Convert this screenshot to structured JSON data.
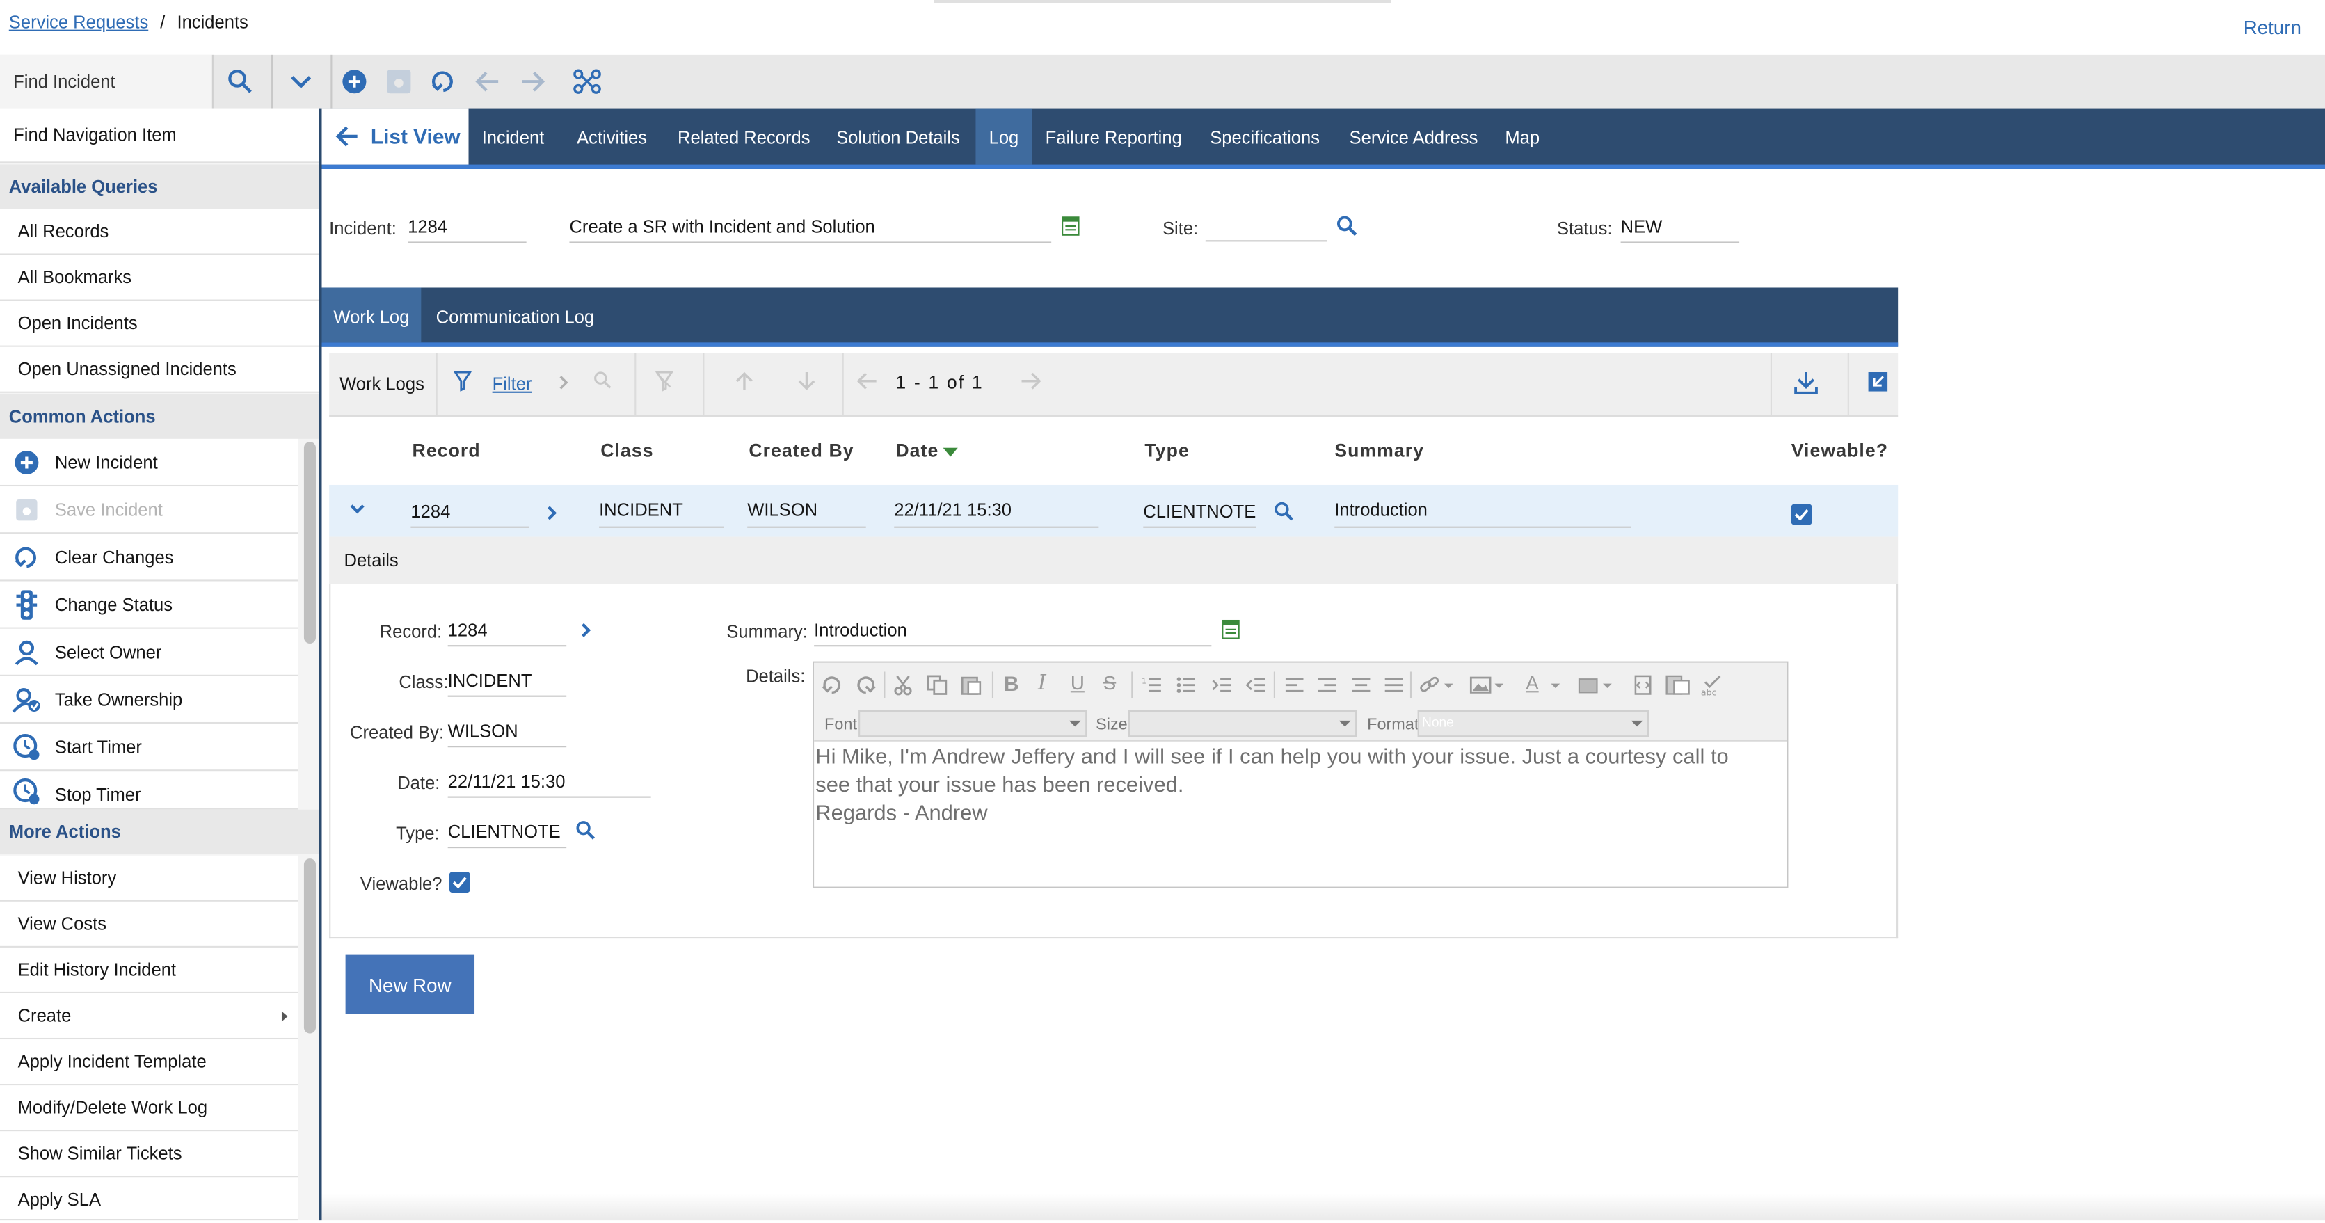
{
  "breadcrumb": {
    "link": "Service Requests",
    "separator": "/",
    "current": "Incidents"
  },
  "return_label": "Return",
  "toolbar": {
    "find_incident": "Find Incident"
  },
  "sidebar": {
    "find_nav": "Find Navigation Item",
    "available_queries_title": "Available Queries",
    "queries": [
      "All Records",
      "All Bookmarks",
      "Open Incidents",
      "Open Unassigned Incidents"
    ],
    "common_actions_title": "Common Actions",
    "common_actions": [
      {
        "label": "New Incident",
        "icon": "plus-circle-icon"
      },
      {
        "label": "Save Incident",
        "icon": "save-icon"
      },
      {
        "label": "Clear Changes",
        "icon": "undo-icon"
      },
      {
        "label": "Change Status",
        "icon": "traffic-light-icon"
      },
      {
        "label": "Select Owner",
        "icon": "person-icon"
      },
      {
        "label": "Take Ownership",
        "icon": "person-check-icon"
      },
      {
        "label": "Start Timer",
        "icon": "clock-start-icon"
      },
      {
        "label": "Stop Timer",
        "icon": "clock-stop-icon"
      }
    ],
    "more_actions_title": "More Actions",
    "more_actions": [
      "View History",
      "View Costs",
      "Edit History Incident",
      "Create",
      "Apply Incident Template",
      "Modify/Delete Work Log",
      "Show Similar Tickets",
      "Apply SLA"
    ]
  },
  "tabs": {
    "list_view": "List View",
    "items": [
      "Incident",
      "Activities",
      "Related Records",
      "Solution Details",
      "Log",
      "Failure Reporting",
      "Specifications",
      "Service Address",
      "Map"
    ],
    "active": "Log"
  },
  "header": {
    "incident_label": "Incident:",
    "incident_value": "1284",
    "description": "Create a SR with Incident and Solution",
    "site_label": "Site:",
    "site_value": "",
    "status_label": "Status:",
    "status_value": "NEW"
  },
  "subtabs": [
    "Work Log",
    "Communication Log"
  ],
  "worklog": {
    "title": "Work Logs",
    "filter": "Filter",
    "pagination": "1 - 1 of 1",
    "columns": [
      "Record",
      "Class",
      "Created By",
      "Date",
      "Type",
      "Summary",
      "Viewable?"
    ],
    "row": {
      "record": "1284",
      "class": "INCIDENT",
      "created_by": "WILSON",
      "date": "22/11/21 15:30",
      "type": "CLIENTNOTE",
      "summary": "Introduction",
      "viewable": true
    }
  },
  "details": {
    "title": "Details",
    "record_label": "Record:",
    "record_value": "1284",
    "class_label": "Class:",
    "class_value": "INCIDENT",
    "created_by_label": "Created By:",
    "created_by_value": "WILSON",
    "date_label": "Date:",
    "date_value": "22/11/21 15:30",
    "type_label": "Type:",
    "type_value": "CLIENTNOTE",
    "viewable_label": "Viewable?",
    "summary_label": "Summary:",
    "summary_value": "Introduction",
    "details_label": "Details:",
    "editor": {
      "font_label": "Font",
      "size_label": "Size",
      "format_label": "Format",
      "format_value": "None",
      "text_line1": "Hi Mike, I'm Andrew Jeffery and I will see if I can help you with your issue. Just a courtesy call to",
      "text_line2": "see that your issue has been received.",
      "text_line3": "Regards - Andrew"
    }
  },
  "new_row_button": "New Row",
  "colors": {
    "nav_dark": "#2e4c70",
    "accent": "#3d7bd1",
    "link": "#2f6cb5",
    "button": "#4473b8"
  }
}
